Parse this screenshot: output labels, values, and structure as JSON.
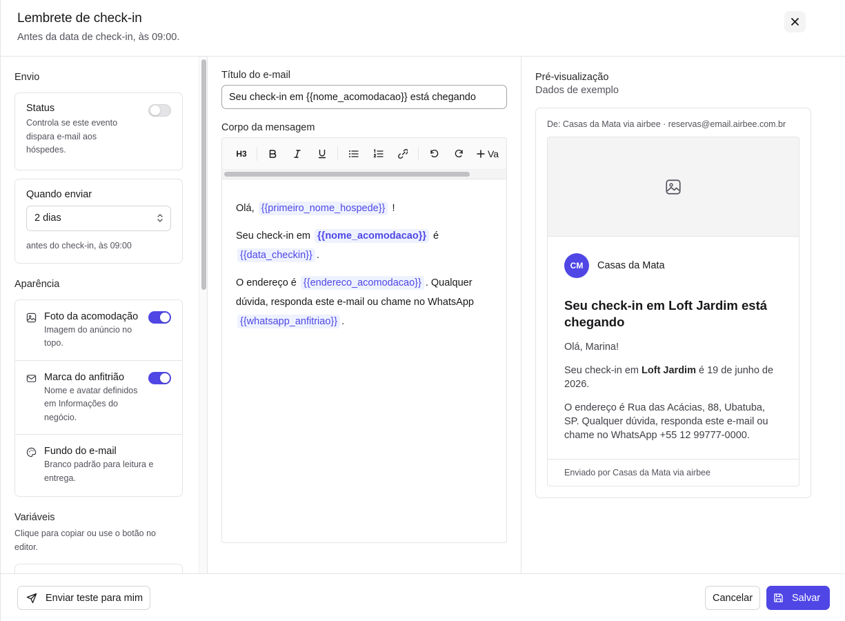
{
  "dialog": {
    "title": "Lembrete de check-in",
    "subtitle": "Antes da data de check-in, às 09:00."
  },
  "left": {
    "envio_label": "Envio",
    "status": {
      "title": "Status",
      "desc": "Controla se este evento dispara e-mail aos hóspedes.",
      "enabled": false
    },
    "quando": {
      "title": "Quando enviar",
      "selected": "2 dias",
      "hint": "antes do check-in, às 09:00"
    },
    "aparencia_label": "Aparência",
    "options": [
      {
        "title": "Foto da acomodação",
        "desc": "Imagem do anúncio no topo.",
        "icon": "image-icon",
        "enabled": true
      },
      {
        "title": "Marca do anfitrião",
        "desc": "Nome e avatar definidos em Informações do negócio.",
        "icon": "mail-icon",
        "enabled": true
      },
      {
        "title": "Fundo do e-mail",
        "desc": "Branco padrão para leitura e entrega.",
        "icon": "palette-icon"
      }
    ],
    "variaveis_label": "Variáveis",
    "variaveis_desc": "Clique para copiar ou use o botão no editor."
  },
  "editor": {
    "title_label": "Título do e-mail",
    "title_value": "Seu check-in em {{nome_acomodacao}} está chegando",
    "body_label": "Corpo da mensagem",
    "toolbar": {
      "heading": "H3",
      "add_variable": "Va"
    },
    "body": {
      "p1_prefix": "Olá,",
      "p1_var": "{{primeiro_nome_hospede}}",
      "p1_suffix": "!",
      "p2_prefix": "Seu check-in em",
      "p2_var1": "{{nome_acomodacao}}",
      "p2_mid": "é",
      "p2_var2": "{{data_checkin}}",
      "p2_suffix": ".",
      "p3_prefix": "O endereço é",
      "p3_var1": "{{endereco_acomodacao}}",
      "p3_mid": ". Qualquer dúvida, responda este e-mail ou chame no WhatsApp",
      "p3_var2": "{{whatsapp_anfitriao}}",
      "p3_suffix": "."
    }
  },
  "preview": {
    "title": "Pré-visualização",
    "subtitle": "Dados de exemplo",
    "from": "De: Casas da Mata via airbee · reservas@email.airbee.com.br",
    "avatar_initials": "CM",
    "brand_name": "Casas da Mata",
    "heading": "Seu check-in em Loft Jardim está chegando",
    "greeting": "Olá, Marina!",
    "p2_prefix": "Seu check-in em",
    "p2_bold": "Loft Jardim",
    "p2_suffix": "é 19 de junho de 2026.",
    "p3": "O endereço é Rua das Acácias, 88, Ubatuba, SP. Qualquer dúvida, responda este e-mail ou chame no WhatsApp +55 12 99777-0000.",
    "footer": "Enviado por Casas da Mata via airbee"
  },
  "footer": {
    "test_button": "Enviar teste para mim",
    "cancel_button": "Cancelar",
    "save_button": "Salvar"
  },
  "colors": {
    "accent": "#4f46e5",
    "variable_bg": "#eef2ff",
    "border": "#e4e4e7"
  }
}
